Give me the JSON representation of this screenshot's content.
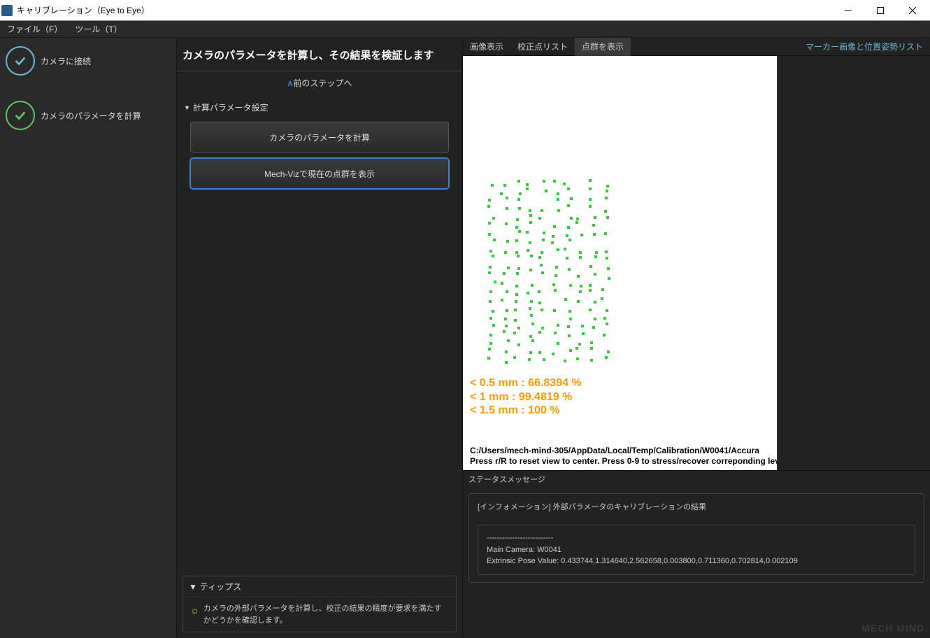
{
  "window": {
    "title": "キャリブレーション（Eye to Eye）"
  },
  "menubar": {
    "file": "ファイル（F）",
    "tool": "ツール（T）"
  },
  "steps": {
    "s1": "カメラに接続",
    "s2": "カメラのパラメータを計算"
  },
  "mid": {
    "title": "カメラのパラメータを計算し、その結果を検証します",
    "prev": "前のステップへ",
    "group1": "計算パラメータ設定",
    "btn_calc": "カメラのパラメータを計算",
    "btn_viz": "Mech-Vizで現在の点群を表示",
    "tips_title": "ティップス",
    "tips_body": "カメラの外部パラメータを計算し、校正の結果の精度が要求を満たすかどうかを確認します。"
  },
  "tabs": {
    "t1": "画像表示",
    "t2": "校正点リスト",
    "t3": "点群を表示"
  },
  "right_link": "マーカー画像と位置姿勢リスト",
  "metrics": {
    "l1": "<  0.5 mm :  66.8394 %",
    "l2": "<    1 mm :  99.4819 %",
    "l3": "<  1.5 mm :     100 %"
  },
  "viz_footer": {
    "path": "C:/Users/mech-mind-305/AppData/Local/Temp/Calibration/W0041/Accura",
    "hint": "Press r/R to reset view to center. Press 0-9 to stress/recover correponding lev"
  },
  "status": {
    "area_title": "ステータスメッセージ",
    "header": "[インフォメーション] 外部パラメータのキャリブレーションの結果",
    "dash": "--------------------------",
    "camera": "Main Camera: W0041",
    "pose": "Extrinsic Pose Value: 0.433744,1.314640,2.562658,0.003800,0.711360,0.702814,0.002109"
  },
  "watermark": "MECH MIND"
}
